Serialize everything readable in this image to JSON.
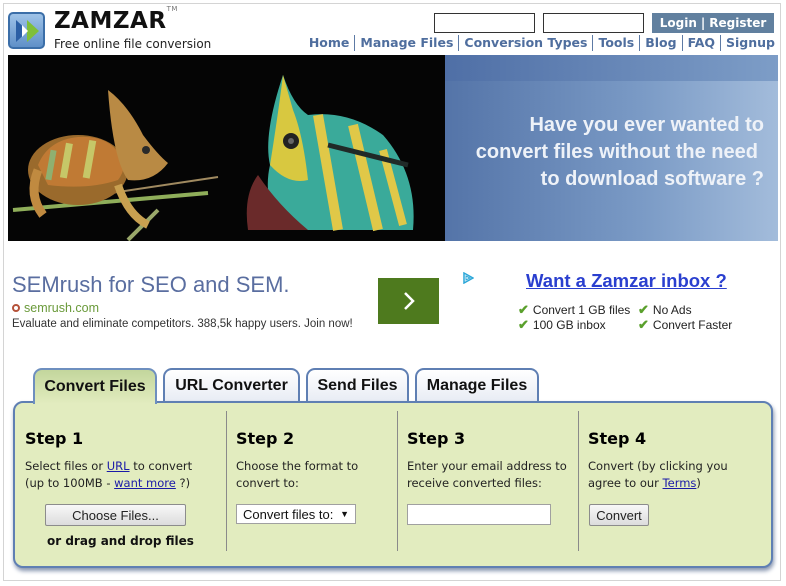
{
  "header": {
    "brand": "ZAMZAR",
    "trademark": "TM",
    "tagline": "Free online file conversion",
    "login_label": "Login",
    "login_separator": "|",
    "register_label": "Register",
    "username_value": "",
    "password_value": "",
    "nav": [
      "Home",
      "Manage Files",
      "Conversion Types",
      "Tools",
      "Blog",
      "FAQ",
      "Signup"
    ]
  },
  "hero": {
    "lines": [
      "Have you ever wanted to",
      "convert files without the need",
      "to download software ?"
    ],
    "image_alt": "two chameleons on branches"
  },
  "ad": {
    "title": "SEMrush for SEO and SEM.",
    "url": "semrush.com",
    "description": "Evaluate and eliminate competitors. 388,5k happy users. Join now!",
    "button_icon": "chevron-right-icon",
    "adchoices_icon": "adchoices-icon"
  },
  "inbox": {
    "title": "Want a Zamzar inbox ?",
    "features": [
      "Convert 1 GB files",
      "No Ads",
      "100 GB inbox",
      "Convert Faster"
    ]
  },
  "tabs": [
    {
      "label": "Convert Files",
      "active": true
    },
    {
      "label": "URL Converter",
      "active": false
    },
    {
      "label": "Send Files",
      "active": false
    },
    {
      "label": "Manage Files",
      "active": false
    }
  ],
  "steps": {
    "step1": {
      "title": "Step 1",
      "text_before_url": "Select files or ",
      "url_link": "URL",
      "text_after_url": " to convert",
      "text_line2_before": "(up to 100MB - ",
      "want_more_link": "want more",
      "text_line2_after": " ?)",
      "choose_button": "Choose Files...",
      "drag_drop": "or drag and drop files"
    },
    "step2": {
      "title": "Step 2",
      "line1": "Choose the format to",
      "line2": "convert to:",
      "select_value": "Convert files to:"
    },
    "step3": {
      "title": "Step 3",
      "line1": "Enter your email address to",
      "line2": "receive converted files:",
      "email_value": ""
    },
    "step4": {
      "title": "Step 4",
      "line1": "Convert (by clicking you",
      "line2_before": "agree to our ",
      "terms_link": "Terms",
      "line2_after": ")",
      "convert_button": "Convert"
    }
  },
  "colors": {
    "nav_link": "#4f6e9e",
    "login_bg": "#61809f",
    "panel_bg": "#e2ecbf",
    "panel_border": "#5f7fb3",
    "inbox_link": "#2a3fcf",
    "ad_button": "#4e7a1e",
    "check": "#5aa02c"
  }
}
